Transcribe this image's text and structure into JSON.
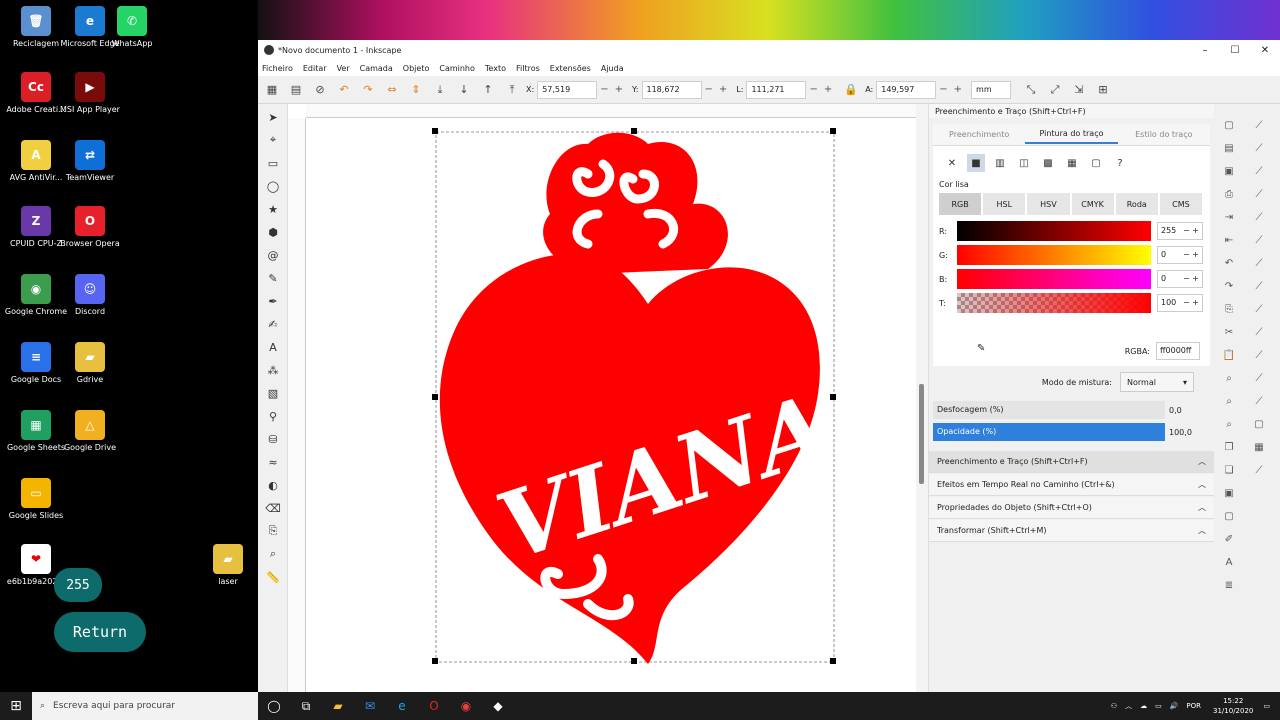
{
  "desktop": {
    "icons": [
      {
        "label": "Reciclagem",
        "color": "#5a8fd0",
        "glyph": "🗑"
      },
      {
        "label": "Microsoft Edge",
        "color": "#1b7bd0",
        "glyph": "e"
      },
      {
        "label": "WhatsApp",
        "color": "#25d366",
        "glyph": "✆"
      },
      {
        "label": "Adobe Creati...",
        "color": "#da1f26",
        "glyph": "Cc"
      },
      {
        "label": "MSI App Player",
        "color": "#7a0b0b",
        "glyph": "▶"
      },
      {
        "label": "AVG AntiVir...",
        "color": "#f0d040",
        "glyph": "A"
      },
      {
        "label": "TeamViewer",
        "color": "#0e6fd6",
        "glyph": "⇄"
      },
      {
        "label": "CPUID CPU-Z",
        "color": "#6a38a8",
        "glyph": "Z"
      },
      {
        "label": "Browser Opera",
        "color": "#e8202a",
        "glyph": "O"
      },
      {
        "label": "Google Chrome",
        "color": "#3b9d4d",
        "glyph": "◉"
      },
      {
        "label": "Discord",
        "color": "#5865f2",
        "glyph": "☺"
      },
      {
        "label": "Google Docs",
        "color": "#2a70e8",
        "glyph": "≡"
      },
      {
        "label": "Gdrive",
        "color": "#e8c040",
        "glyph": "▰"
      },
      {
        "label": "Google Sheets",
        "color": "#20a060",
        "glyph": "▦"
      },
      {
        "label": "Google Drive",
        "color": "#f0b020",
        "glyph": "△"
      },
      {
        "label": "Google Slides",
        "color": "#f4b400",
        "glyph": "▭"
      },
      {
        "label": "e6b1b9a202...",
        "color": "#ffffff",
        "glyph": "❤"
      },
      {
        "label": "laser",
        "color": "#e8c040",
        "glyph": "▰"
      }
    ],
    "pill_255": "255",
    "pill_return": "Return"
  },
  "window": {
    "title": "*Novo documento 1 - Inkscape",
    "controls": [
      "–",
      "☐",
      "✕"
    ]
  },
  "menu": [
    "Ficheiro",
    "Editar",
    "Ver",
    "Camada",
    "Objeto",
    "Caminho",
    "Texto",
    "Filtros",
    "Extensões",
    "Ajuda"
  ],
  "toolbar": {
    "x_label": "X:",
    "x_value": "57,519",
    "y_label": "Y:",
    "y_value": "118,672",
    "l_label": "L:",
    "l_value": "111,271",
    "a_label": "A:",
    "a_value": "149,597",
    "unit": "mm"
  },
  "dock": {
    "title": "Preenchimento e Traço (Shift+Ctrl+F)",
    "tabs": [
      "Preenchimento",
      "Pintura do traço",
      "Estilo do traço"
    ],
    "flat_color_label": "Cor lisa",
    "modes": [
      "RGB",
      "HSL",
      "HSV",
      "CMYK",
      "Roda",
      "CMS"
    ],
    "channels": [
      {
        "label": "R:",
        "value": "255"
      },
      {
        "label": "G:",
        "value": "0"
      },
      {
        "label": "B:",
        "value": "0"
      },
      {
        "label": "T:",
        "value": "100"
      }
    ],
    "rgba_label": "RGBA:",
    "rgba_value": "ff0000ff",
    "blend_label": "Modo de mistura:",
    "blend_value": "Normal",
    "blur_label": "Desfocagem (%)",
    "blur_value": "0,0",
    "opacity_label": "Opacidade (%)",
    "opacity_value": "100,0",
    "sections": [
      "Preenchimento e Traço (Shift+Ctrl+F)",
      "Efeitos em Tempo Real no Caminho (Ctrl+&)",
      "Propriedades do Objeto (Shift+Ctrl+O)",
      "Transformar (Shift+Ctrl+M)"
    ]
  },
  "artwork": {
    "text": "VIANA",
    "color": "#ff0000"
  },
  "taskbar": {
    "search_placeholder": "Escreva aqui para procurar",
    "lang": "POR",
    "time": "15:22",
    "date": "31/10/2020"
  }
}
